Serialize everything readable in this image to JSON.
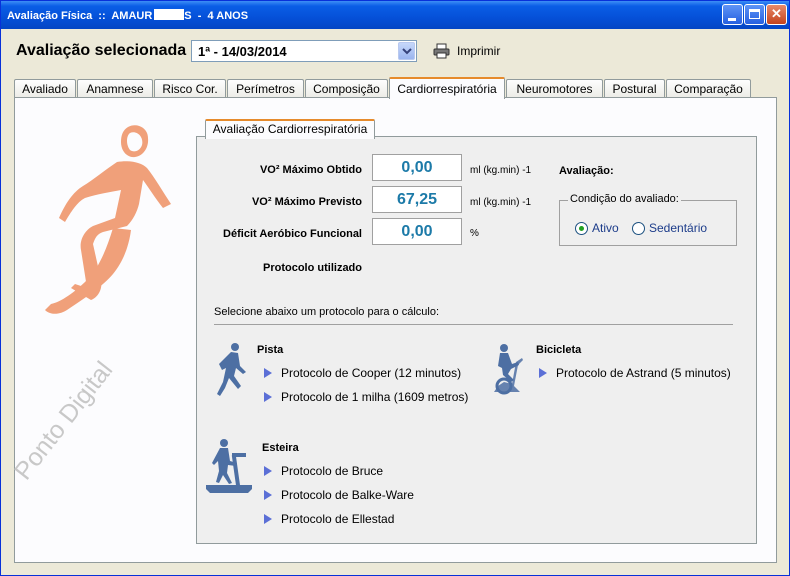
{
  "window": {
    "title": "Avaliação Física  ::  AMAUR",
    "title_suffix": "S  -  4 ANOS"
  },
  "header": {
    "label": "Avaliação selecionada",
    "selected_evaluation": "1ª - 14/03/2014",
    "print_label": "Imprimir"
  },
  "tabs": [
    {
      "label": "Avaliado"
    },
    {
      "label": "Anamnese"
    },
    {
      "label": "Risco Cor."
    },
    {
      "label": "Perímetros"
    },
    {
      "label": "Composição"
    },
    {
      "label": "Cardiorrespiratória",
      "active": true
    },
    {
      "label": "Neuromotores"
    },
    {
      "label": "Postural"
    },
    {
      "label": "Comparação"
    }
  ],
  "watermark": "Ponto Digital",
  "cardio": {
    "tab_label": "Avaliação Cardiorrespiratória",
    "fields": [
      {
        "label": "VO² Máximo Obtido",
        "value": "0,00",
        "unit": "ml (kg.min) -1"
      },
      {
        "label": "VO² Máximo Previsto",
        "value": "67,25",
        "unit": "ml (kg.min) -1"
      },
      {
        "label": "Déficit Aeróbico Funcional",
        "value": "0,00",
        "unit": "%"
      }
    ],
    "protocol_used_label": "Protocolo utilizado",
    "evaluation_label": "Avaliação:",
    "condition": {
      "legend": "Condição do avaliado:",
      "options": [
        {
          "label": "Ativo",
          "selected": true
        },
        {
          "label": "Sedentário",
          "selected": false
        }
      ]
    },
    "instruction": "Selecione abaixo um protocolo para o cálculo:",
    "sections": {
      "pista": {
        "title": "Pista",
        "protocols": [
          "Protocolo de Cooper (12 minutos)",
          "Protocolo de 1 milha (1609 metros)"
        ]
      },
      "bicicleta": {
        "title": "Bicicleta",
        "protocols": [
          "Protocolo de Astrand (5 minutos)"
        ]
      },
      "esteira": {
        "title": "Esteira",
        "protocols": [
          "Protocolo de Bruce",
          "Protocolo de Balke-Ware",
          "Protocolo de Ellestad"
        ]
      }
    }
  },
  "colors": {
    "titlebar": "#0550d8",
    "active_tab_accent": "#e68b2c",
    "value_text": "#1c7aa8",
    "runner": "#f0a07a",
    "protocol_arrow": "#5b6fd6",
    "radio_dot": "#21a121"
  },
  "icons": {
    "print": "printer-icon",
    "runner": "runner-silhouette-icon",
    "pista": "running-person-icon",
    "bicicleta": "stationary-bike-icon",
    "esteira": "treadmill-icon"
  }
}
